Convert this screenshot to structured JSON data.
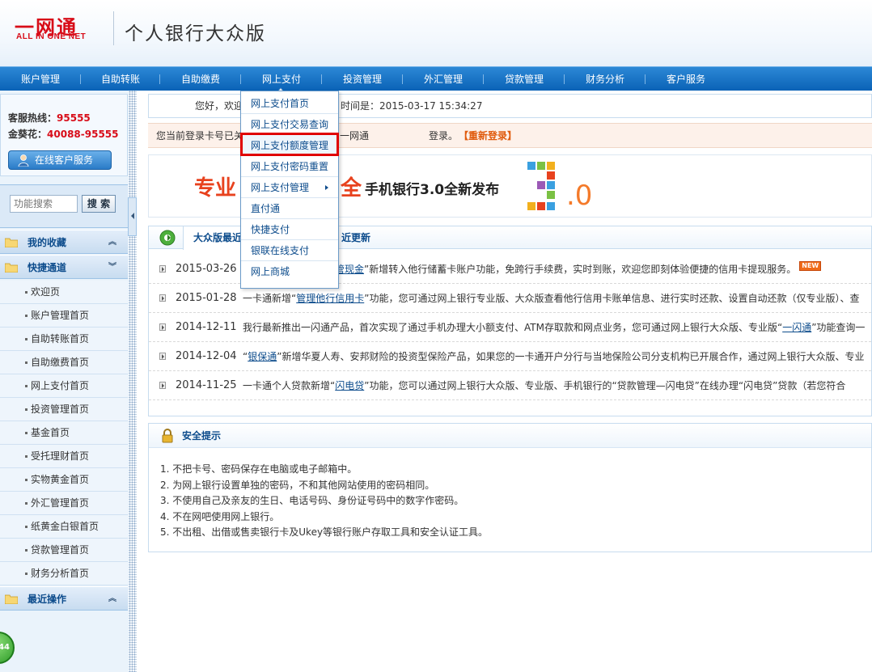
{
  "header": {
    "logo_cn": "一网通",
    "logo_en": "ALL IN ONE NET",
    "site_title": "个人银行大众版"
  },
  "nav": {
    "items": [
      "账户管理",
      "自助转账",
      "自助缴费",
      "网上支付",
      "投资管理",
      "外汇管理",
      "贷款管理",
      "财务分析",
      "客户服务"
    ]
  },
  "dropdown": {
    "items": [
      "网上支付首页",
      "网上支付交易查询",
      "网上支付额度管理",
      "网上支付密码重置",
      "网上支付管理",
      "直付通",
      "快捷支付",
      "银联在线支付",
      "网上商城"
    ],
    "highlighted": "网上支付额度管理"
  },
  "sidebar": {
    "hotline_label": "客服热线：",
    "hotline_number": "95555",
    "gold_label": "金葵花：",
    "gold_number": "40088-95555",
    "online_service": "在线客户服务",
    "search_placeholder": "功能搜索",
    "search_button": "搜 索",
    "favorites": "我的收藏",
    "quick_channel": "快捷通道",
    "quick_items": [
      "欢迎页",
      "账户管理首页",
      "自助转账首页",
      "自助缴费首页",
      "网上支付首页",
      "投资管理首页",
      "基金首页",
      "受托理财首页",
      "实物黄金首页",
      "外汇管理首页",
      "纸黄金白银首页",
      "贷款管理首页",
      "财务分析首页"
    ],
    "recent_ops": "最近操作",
    "green_badge": "44"
  },
  "welcome": {
    "greeting_prefix": "您好，欢迎",
    "time_text": "时间是：2015-03-17 15:34:27"
  },
  "login": {
    "text1": "您当前登录卡号已关",
    "text2": "一网通",
    "text3": "登录。",
    "relogin": "【重新登录】"
  },
  "banner": {
    "big_left": "专业",
    "big_right": "全",
    "subtitle": "手机银行3.0全新发布",
    "version_tail": ".0"
  },
  "news": {
    "tab_active": "大众版最近",
    "tab_other": "近更新",
    "rows": [
      {
        "date": "2015-03-26",
        "pre": "",
        "link": "管现金",
        "post": "”新增转入他行储蓄卡账户功能，免跨行手续费，实时到账，欢迎您即刻体验便捷的信用卡提现服务。",
        "new": "NEW"
      },
      {
        "date": "2015-01-28",
        "pre": "一卡通新增“",
        "link": "管理他行信用卡",
        "post": "”功能，您可通过网上银行专业版、大众版查看他行信用卡账单信息、进行实时还款、设置自动还款（仅专业版）、查",
        "new": ""
      },
      {
        "date": "2014-12-11",
        "pre": "我行最新推出一闪通产品，首次实现了通过手机办理大小额支付、ATM存取款和网点业务，您可通过网上银行大众版、专业版“",
        "link": "一闪通",
        "post": "”功能查询一",
        "new": ""
      },
      {
        "date": "2014-12-04",
        "pre": "“",
        "link": "银保通",
        "post": "”新增华夏人寿、安邦财险的投资型保险产品，如果您的一卡通开户分行与当地保险公司分支机构已开展合作，通过网上银行大众版、专业",
        "new": ""
      },
      {
        "date": "2014-11-25",
        "pre": "一卡通个人贷款新增“",
        "link": "闪电贷",
        "post": "”功能，您可以通过网上银行大众版、专业版、手机银行的“贷款管理—闪电贷”在线办理“闪电贷”贷款（若您符合",
        "new": ""
      }
    ]
  },
  "safety": {
    "title": "安全提示",
    "lines": [
      "1. 不把卡号、密码保存在电脑或电子邮箱中。",
      "2. 为网上银行设置单独的密码，不和其他网站使用的密码相同。",
      "3. 不使用自己及亲友的生日、电话号码、身份证号码中的数字作密码。",
      "4. 不在网吧使用网上银行。",
      "5. 不出租、出借或售卖银行卡及Ukey等银行账户存取工具和安全认证工具。"
    ]
  },
  "colors": {
    "brand_red": "#d80c18",
    "nav_blue": "#0a62b6",
    "link_blue": "#0d4c8c",
    "relogin_orange": "#e05a0c",
    "highlight_box": "#e00000"
  }
}
